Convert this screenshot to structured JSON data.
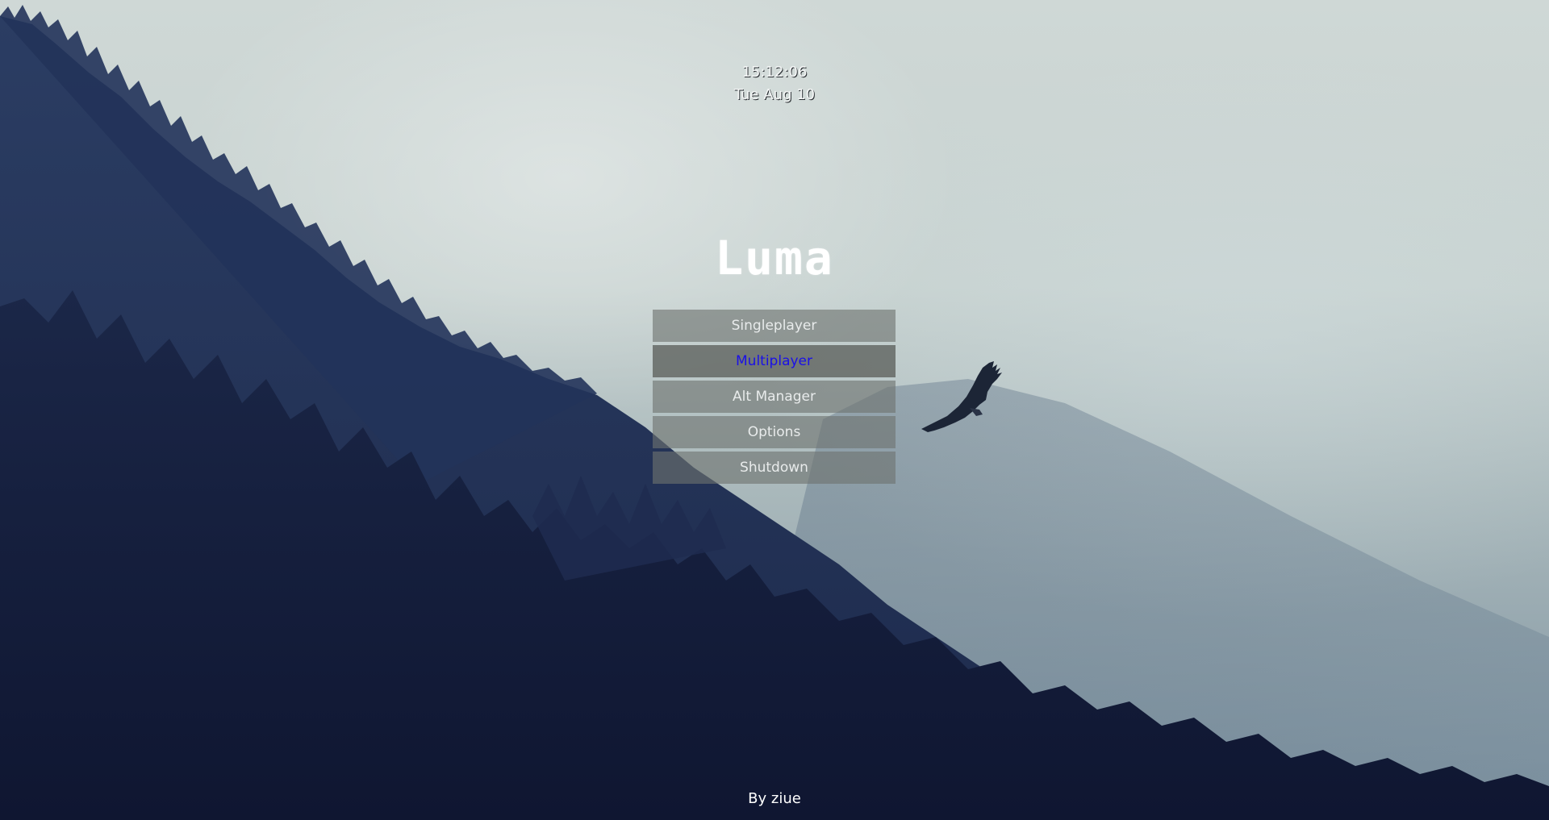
{
  "clock": {
    "time": "15:12:06",
    "date": "Tue Aug 10"
  },
  "title": "Luma",
  "menu": {
    "items": [
      {
        "label": "Singleplayer",
        "selected": false
      },
      {
        "label": "Multiplayer",
        "selected": true
      },
      {
        "label": "Alt Manager",
        "selected": false
      },
      {
        "label": "Options",
        "selected": false
      },
      {
        "label": "Shutdown",
        "selected": false
      }
    ]
  },
  "credit": "By ziue",
  "colors": {
    "selected_text": "#1a10e8",
    "button_text": "#e8ebeb",
    "forest_dark": "#121a38"
  },
  "background": {
    "icon": "eagle-icon"
  }
}
